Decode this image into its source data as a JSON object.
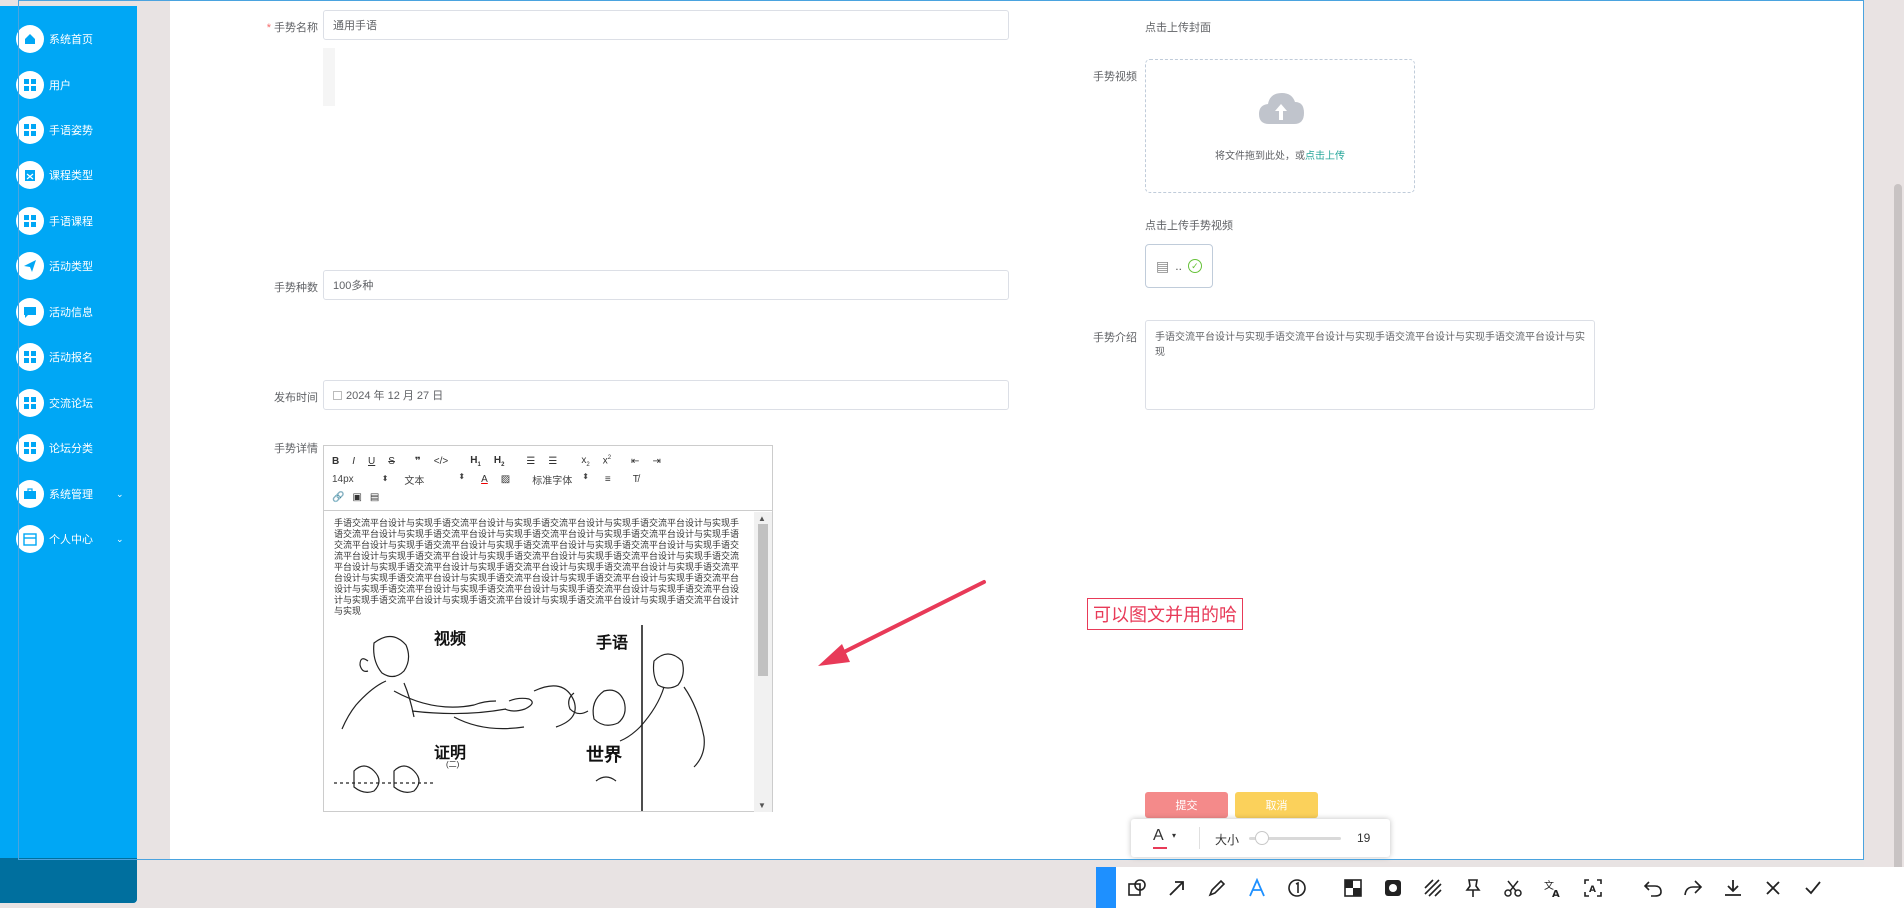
{
  "sidebar": {
    "items": [
      {
        "label": "系统首页",
        "icon": "home-icon"
      },
      {
        "label": "用户",
        "icon": "grid-icon"
      },
      {
        "label": "手语姿势",
        "icon": "grid-icon"
      },
      {
        "label": "课程类型",
        "icon": "clipboard-icon"
      },
      {
        "label": "手语课程",
        "icon": "grid-icon"
      },
      {
        "label": "活动类型",
        "icon": "send-icon"
      },
      {
        "label": "活动信息",
        "icon": "chat-icon"
      },
      {
        "label": "活动报名",
        "icon": "grid-icon"
      },
      {
        "label": "交流论坛",
        "icon": "grid-icon"
      },
      {
        "label": "论坛分类",
        "icon": "grid-icon"
      },
      {
        "label": "系统管理",
        "icon": "briefcase-icon",
        "has_arrow": true
      },
      {
        "label": "个人中心",
        "icon": "calendar-icon",
        "has_arrow": true
      }
    ]
  },
  "form": {
    "name_label": "手势名称",
    "name_value": "通用手语",
    "count_label": "手势种数",
    "count_value": "100多种",
    "date_label": "发布时间",
    "date_value": "2024 年 12 月 27 日",
    "detail_label": "手势详情",
    "cover_hint": "点击上传封面",
    "video_label": "手势视频",
    "upload_text": "将文件拖到此处，或",
    "upload_link": "点击上传",
    "video_hint": "点击上传手势视频",
    "file_name": "..",
    "intro_label": "手势介绍",
    "intro_value": "手语交流平台设计与实现手语交流平台设计与实现手语交流平台设计与实现手语交流平台设计与实现",
    "submit_label": "提交",
    "cancel_label": "取消"
  },
  "editor": {
    "font_size": "14px",
    "text_style": "文本",
    "font_family": "标准字体",
    "content": "手语交流平台设计与实现手语交流平台设计与实现手语交流平台设计与实现手语交流平台设计与实现手语交流平台设计与实现手语交流平台设计与实现手语交流平台设计与实现手语交流平台设计与实现手语交流平台设计与实现手语交流平台设计与实现手语交流平台设计与实现手语交流平台设计与实现手语交流平台设计与实现手语交流平台设计与实现手语交流平台设计与实现手语交流平台设计与实现手语交流平台设计与实现手语交流平台设计与实现手语交流平台设计与实现手语交流平台设计与实现手语交流平台设计与实现手语交流平台设计与实现手语交流平台设计与实现手语交流平台设计与实现手语交流平台设计与实现手语交流平台设计与实现手语交流平台设计与实现手语交流平台设计与实现手语交流平台设计与实现手语交流平台设计与实现手语交流平台设计与实现手语交流平台设计与实现手语交流平台设计与实现",
    "image_words": [
      "视频",
      "手语",
      "证明",
      "世界"
    ],
    "image_sub": "(二)"
  },
  "annotation": {
    "text": "可以图文并用的哈",
    "color": "#e83a58"
  },
  "size_popup": {
    "label": "大小",
    "value": "19"
  },
  "colors": {
    "sidebar": "#00a7f5",
    "submit": "#f48a8a",
    "cancel": "#fbd15b",
    "accent_link": "#26a69a"
  }
}
